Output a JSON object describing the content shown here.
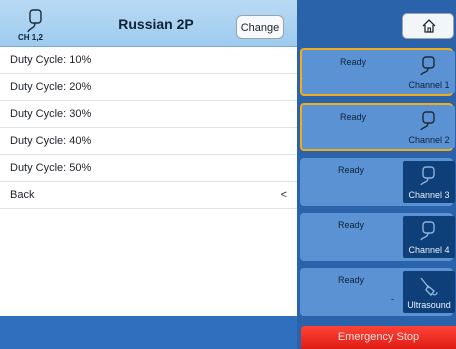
{
  "header": {
    "channel_label": "CH 1,2",
    "title": "Russian 2P",
    "change_label": "Change"
  },
  "menu": {
    "items": [
      {
        "label": "Duty Cycle: 10%"
      },
      {
        "label": "Duty Cycle: 20%"
      },
      {
        "label": "Duty Cycle: 30%"
      },
      {
        "label": "Duty Cycle: 40%"
      },
      {
        "label": "Duty Cycle: 50%"
      },
      {
        "label": "Back",
        "arrow": "<"
      }
    ]
  },
  "channels": [
    {
      "status": "Ready",
      "label": "Channel 1",
      "icon": "electrode-icon",
      "selected": true
    },
    {
      "status": "Ready",
      "label": "Channel 2",
      "icon": "electrode-icon",
      "selected": true
    },
    {
      "status": "Ready",
      "label": "Channel 3",
      "icon": "electrode-icon",
      "selected": false
    },
    {
      "status": "Ready",
      "label": "Channel 4",
      "icon": "electrode-icon",
      "selected": false
    },
    {
      "status": "Ready",
      "dash": "-",
      "label": "Ultrasound",
      "icon": "ultrasound-probe-icon",
      "selected": false
    }
  ],
  "emergency_stop_label": "Emergency Stop",
  "colors": {
    "header_bg": "#a6cff0",
    "sidebar_bg": "#2a63aa",
    "card_bg": "#5a92d4",
    "selected_border": "#f0ad1b",
    "estop": "#e8231a"
  }
}
